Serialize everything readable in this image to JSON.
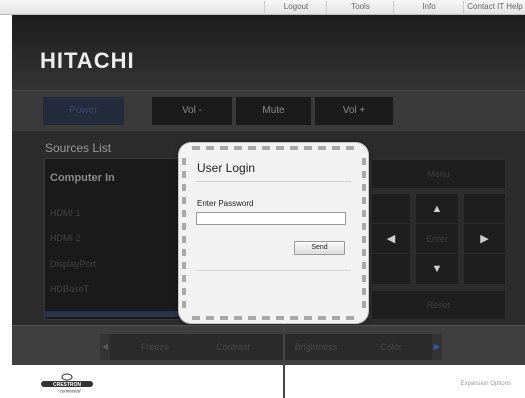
{
  "top_links": [
    "Logout",
    "Tools",
    "Info",
    "Contact IT Help"
  ],
  "brand": "HITACHI",
  "toolbar": {
    "power": "Power",
    "vol_down": "Vol -",
    "mute": "Mute",
    "vol_up": "Vol +"
  },
  "sources": {
    "title": "Sources List",
    "header": "Computer In",
    "items": [
      "HDMI 1",
      "HDMI 2",
      "DisplayPort",
      "HDBaseT"
    ]
  },
  "remote": {
    "menu": "Menu",
    "enter": "Enter",
    "reset": "Reset"
  },
  "bottom": {
    "freeze": "Freeze",
    "contrast": "Contrast",
    "brightness": "Brightness",
    "color": "Color"
  },
  "footer": {
    "crestron_top": "CRESTRON",
    "crestron_bottom": "connected",
    "expansion": "Expansion Options"
  },
  "dialog": {
    "title": "User Login",
    "password_label": "Enter Password",
    "password_value": "",
    "send_label": "Send"
  },
  "colors": {
    "power_bg": "#232b3c",
    "dialog_bg": "#f2f2f2"
  }
}
